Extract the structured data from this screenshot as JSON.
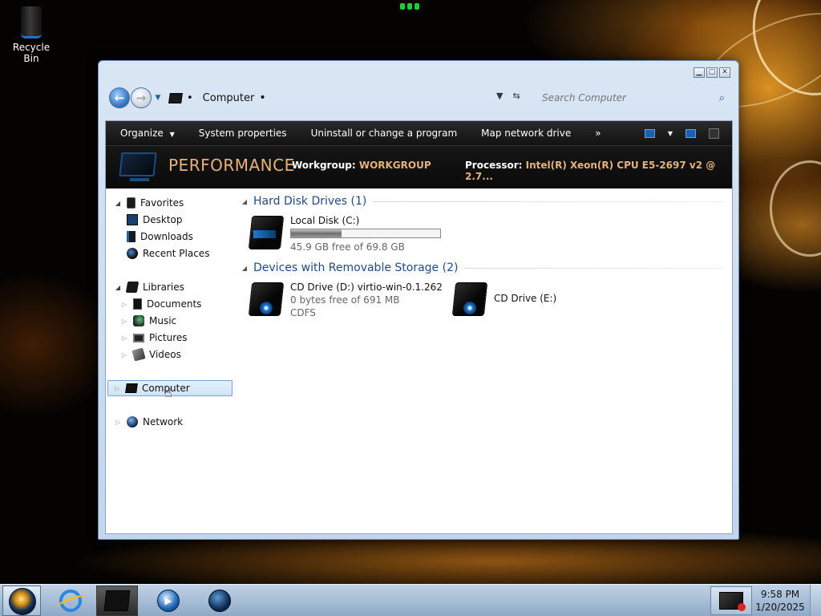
{
  "desktop": {
    "recycle_bin_label": "Recycle Bin"
  },
  "window": {
    "address": {
      "breadcrumb": "Computer",
      "search_placeholder": "Search Computer"
    },
    "toolbar": {
      "organize": "Organize",
      "system_properties": "System properties",
      "uninstall": "Uninstall or change a program",
      "map_drive": "Map network drive",
      "more": "»"
    },
    "details": {
      "computer_name": "PERFORMANCE",
      "workgroup_label": "Workgroup:",
      "workgroup_value": "WORKGROUP",
      "processor_label": "Processor:",
      "processor_value": "Intel(R) Xeon(R) CPU E5-2697 v2 @ 2.7..."
    },
    "nav": {
      "favorites": "Favorites",
      "desktop": "Desktop",
      "downloads": "Downloads",
      "recent_places": "Recent Places",
      "libraries": "Libraries",
      "documents": "Documents",
      "music": "Music",
      "pictures": "Pictures",
      "videos": "Videos",
      "computer": "Computer",
      "network": "Network"
    },
    "groups": {
      "hdd_header": "Hard Disk Drives (1)",
      "removable_header": "Devices with Removable Storage (2)"
    },
    "drives": {
      "c": {
        "name": "Local Disk (C:)",
        "free_text": "45.9 GB free of 69.8 GB",
        "used_fraction": 0.34
      },
      "d": {
        "name": "CD Drive (D:) virtio-win-0.1.262",
        "free_text": "0 bytes free of 691 MB",
        "fs": "CDFS"
      },
      "e": {
        "name": "CD Drive (E:)"
      }
    }
  },
  "taskbar": {
    "time": "9:58 PM",
    "date": "1/20/2025"
  },
  "colors": {
    "details_accent": "#e6b27a",
    "group_header": "#1e4a86",
    "selection": "#cfe3f7"
  }
}
